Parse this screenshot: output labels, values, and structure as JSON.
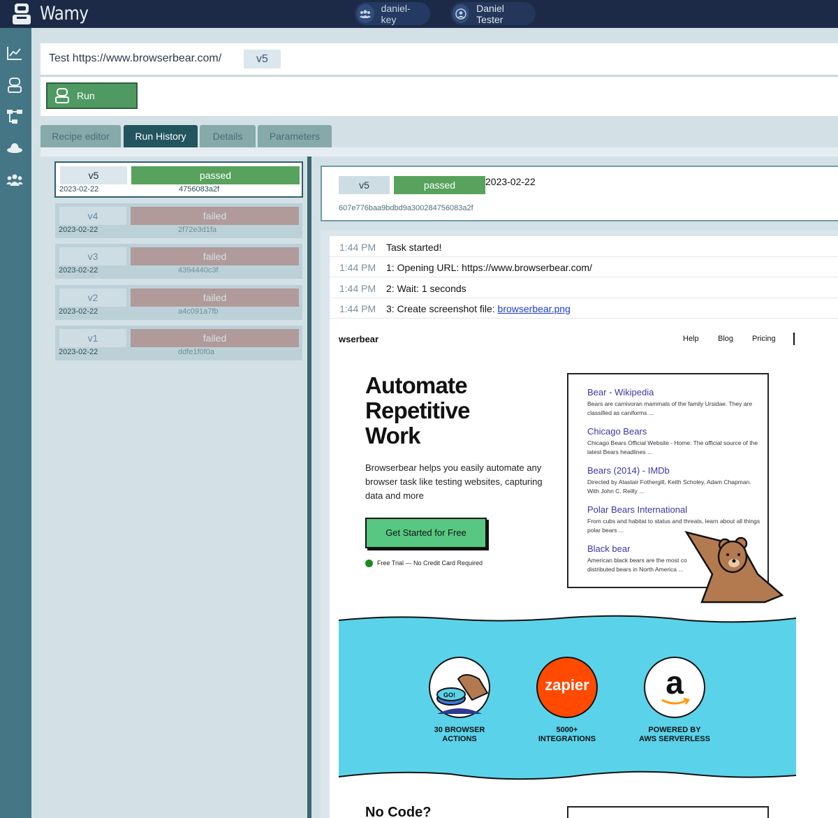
{
  "app": {
    "title": "Wamy"
  },
  "topbar": {
    "key_label": "daniel-key",
    "user_label": "Daniel Tester"
  },
  "sidebar": {
    "icons": [
      "chart-icon",
      "robot-icon",
      "workflow-icon",
      "hat-icon",
      "team-icon"
    ]
  },
  "header": {
    "title": "Test https://www.browserbear.com/",
    "version": "v5",
    "run_label": "Run"
  },
  "tabs": [
    {
      "label": "Recipe editor"
    },
    {
      "label": "Run History"
    },
    {
      "label": "Details"
    },
    {
      "label": "Parameters"
    }
  ],
  "history": [
    {
      "version": "v5",
      "status": "passed",
      "date": "2023-02-22",
      "hash": "4756083a2f"
    },
    {
      "version": "v4",
      "status": "failed",
      "date": "2023-02-22",
      "hash": "2f72e3d1fa"
    },
    {
      "version": "v3",
      "status": "failed",
      "date": "2023-02-22",
      "hash": "4394440c3f"
    },
    {
      "version": "v2",
      "status": "failed",
      "date": "2023-02-22",
      "hash": "a4c091a7fb"
    },
    {
      "version": "v1",
      "status": "failed",
      "date": "2023-02-22",
      "hash": "ddfe1f0f0a"
    }
  ],
  "detail": {
    "version": "v5",
    "status": "passed",
    "date": "2023-02-22",
    "hash": "607e776baa9bdbd9a300284756083a2f"
  },
  "log": [
    {
      "time": "1:44 PM",
      "message": "Task started!"
    },
    {
      "time": "1:44 PM",
      "message": "1: Opening URL: https://www.browserbear.com/"
    },
    {
      "time": "1:44 PM",
      "message": "2: Wait: 1 seconds"
    },
    {
      "time": "1:44 PM",
      "message": "3: Create screenshot file: ",
      "link": "browserbear.png"
    }
  ],
  "screenshot": {
    "brand": "wserbear",
    "nav": [
      "Help",
      "Blog",
      "Pricing"
    ],
    "hero_lines": [
      "Automate",
      "Repetitive",
      "Work"
    ],
    "sub": "Browserbear helps you easily automate any browser task like testing websites, capturing data and more",
    "cta": "Get Started for Free",
    "trial": "Free Trial — No Credit Card Required",
    "results": [
      {
        "title": "Bear - Wikipedia",
        "desc": "Bears are carnivoran mammals of the family Ursidae. They are classified as caniforms ..."
      },
      {
        "title": "Chicago Bears",
        "desc": "Chicago Bears Official Website - Home: The official source of the latest Bears headlines ..."
      },
      {
        "title": "Bears (2014) - IMDb",
        "desc": "Directed by Alastair Fothergill, Keith Scholey, Adam Chapman. With John C. Reilly ..."
      },
      {
        "title": "Polar Bears International",
        "desc": "From cubs and habitat to status and threats, learn about all things polar bears ..."
      },
      {
        "title": "Black bear",
        "desc": "American black bears are the most co distributed bears in North America ..."
      }
    ],
    "features": [
      {
        "line1": "30 BROWSER",
        "line2": "ACTIONS",
        "badge_text": "GO!"
      },
      {
        "line1": "5000+",
        "line2": "INTEGRATIONS",
        "badge_text": "zapier"
      },
      {
        "line1": "POWERED BY",
        "line2": "AWS SERVERLESS",
        "badge_text": "a"
      }
    ],
    "nocode": "No Code?"
  },
  "colors": {
    "topbar": "#1c2a48",
    "sidebar": "#447685",
    "passed": "#57a25c",
    "failed": "#b09a9a",
    "active_tab": "#22555e"
  }
}
